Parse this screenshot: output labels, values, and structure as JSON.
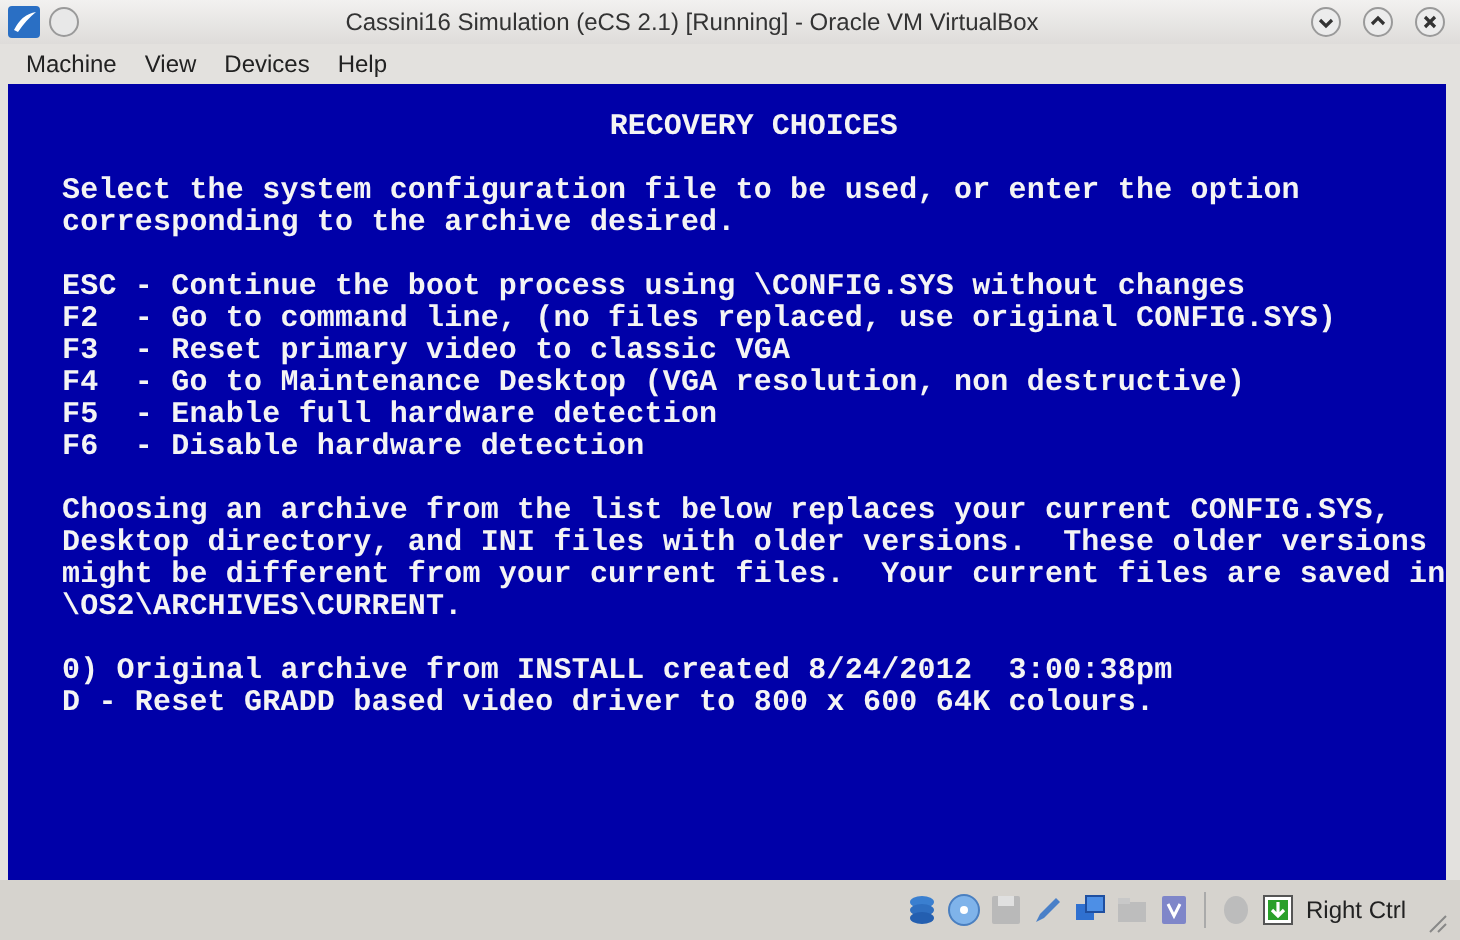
{
  "window": {
    "title": "Cassini16 Simulation (eCS 2.1) [Running] - Oracle VM VirtualBox"
  },
  "menu": [
    "Machine",
    "View",
    "Devices",
    "Help"
  ],
  "screen": {
    "heading": "RECOVERY CHOICES",
    "blocks": [
      [
        "Select the system configuration file to be used, or enter the option",
        "corresponding to the archive desired."
      ],
      [
        "ESC - Continue the boot process using \\CONFIG.SYS without changes",
        "F2  - Go to command line, (no files replaced, use original CONFIG.SYS)",
        "F3  - Reset primary video to classic VGA",
        "F4  - Go to Maintenance Desktop (VGA resolution, non destructive)",
        "F5  - Enable full hardware detection",
        "F6  - Disable hardware detection"
      ],
      [
        "Choosing an archive from the list below replaces your current CONFIG.SYS,",
        "Desktop directory, and INI files with older versions.  These older versions",
        "might be different from your current files.  Your current files are saved in",
        "\\OS2\\ARCHIVES\\CURRENT."
      ],
      [
        "0) Original archive from INSTALL created 8/24/2012  3:00:38pm",
        "D - Reset GRADD based video driver to 800 x 600 64K colours."
      ]
    ]
  },
  "status_bar": {
    "host_key": "Right Ctrl"
  }
}
